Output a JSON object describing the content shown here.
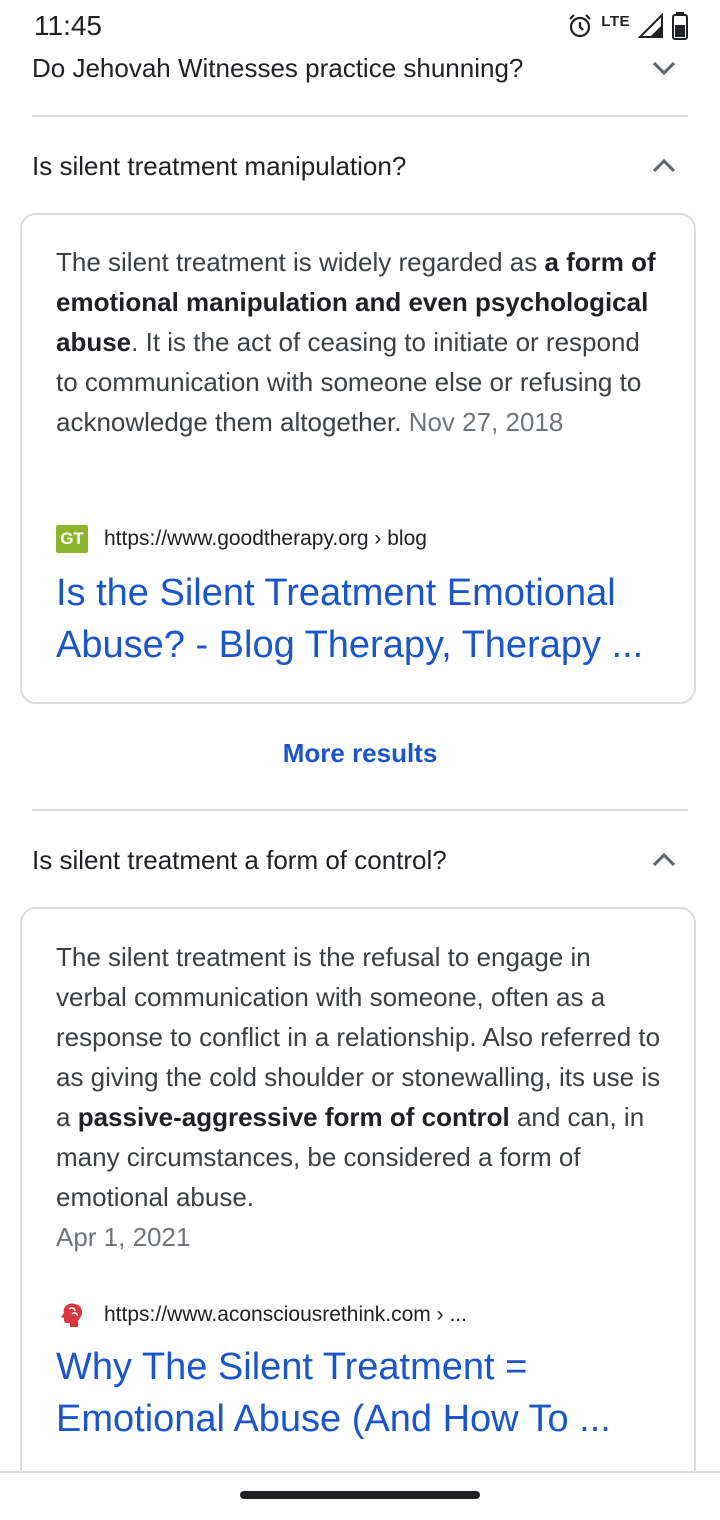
{
  "status": {
    "time": "11:45",
    "network": "LTE"
  },
  "faq": [
    {
      "question": "Do Jehovah Witnesses practice shunning?",
      "expanded": false
    },
    {
      "question": "Is silent treatment manipulation?",
      "expanded": true,
      "snippet_pre": "The silent treatment is widely regarded as ",
      "snippet_bold": "a form of emotional manipulation and even psychological abuse",
      "snippet_post": ". It is the act of ceasing to initiate or respond to communication with someone else or refusing to acknowledge them altogether.",
      "date": "Nov 27, 2018",
      "source_url": "https://www.goodtherapy.org › blog",
      "favicon_text": "GT",
      "title": "Is the Silent Treatment Emotional Abuse? - Blog Therapy, Therapy ..."
    },
    {
      "question": "Is silent treatment a form of control?",
      "expanded": true,
      "snippet_pre": "The silent treatment is the refusal to engage in verbal communication with someone, often as a response to conflict in a relationship. Also referred to as giving the cold shoulder or stonewalling, its use is a ",
      "snippet_bold": "passive-aggressive form of control",
      "snippet_post": " and can, in many circumstances, be considered a form of emotional abuse.",
      "date": "Apr 1, 2021",
      "source_url": "https://www.aconsciousrethink.com › ...",
      "title": "Why The Silent Treatment = Emotional Abuse (And How To ..."
    }
  ],
  "more_results": "More results",
  "colors": {
    "link": "#1a56c9",
    "divider": "#dadce0",
    "gt_favicon": "#8cb52c",
    "acr_favicon": "#d9363e"
  }
}
